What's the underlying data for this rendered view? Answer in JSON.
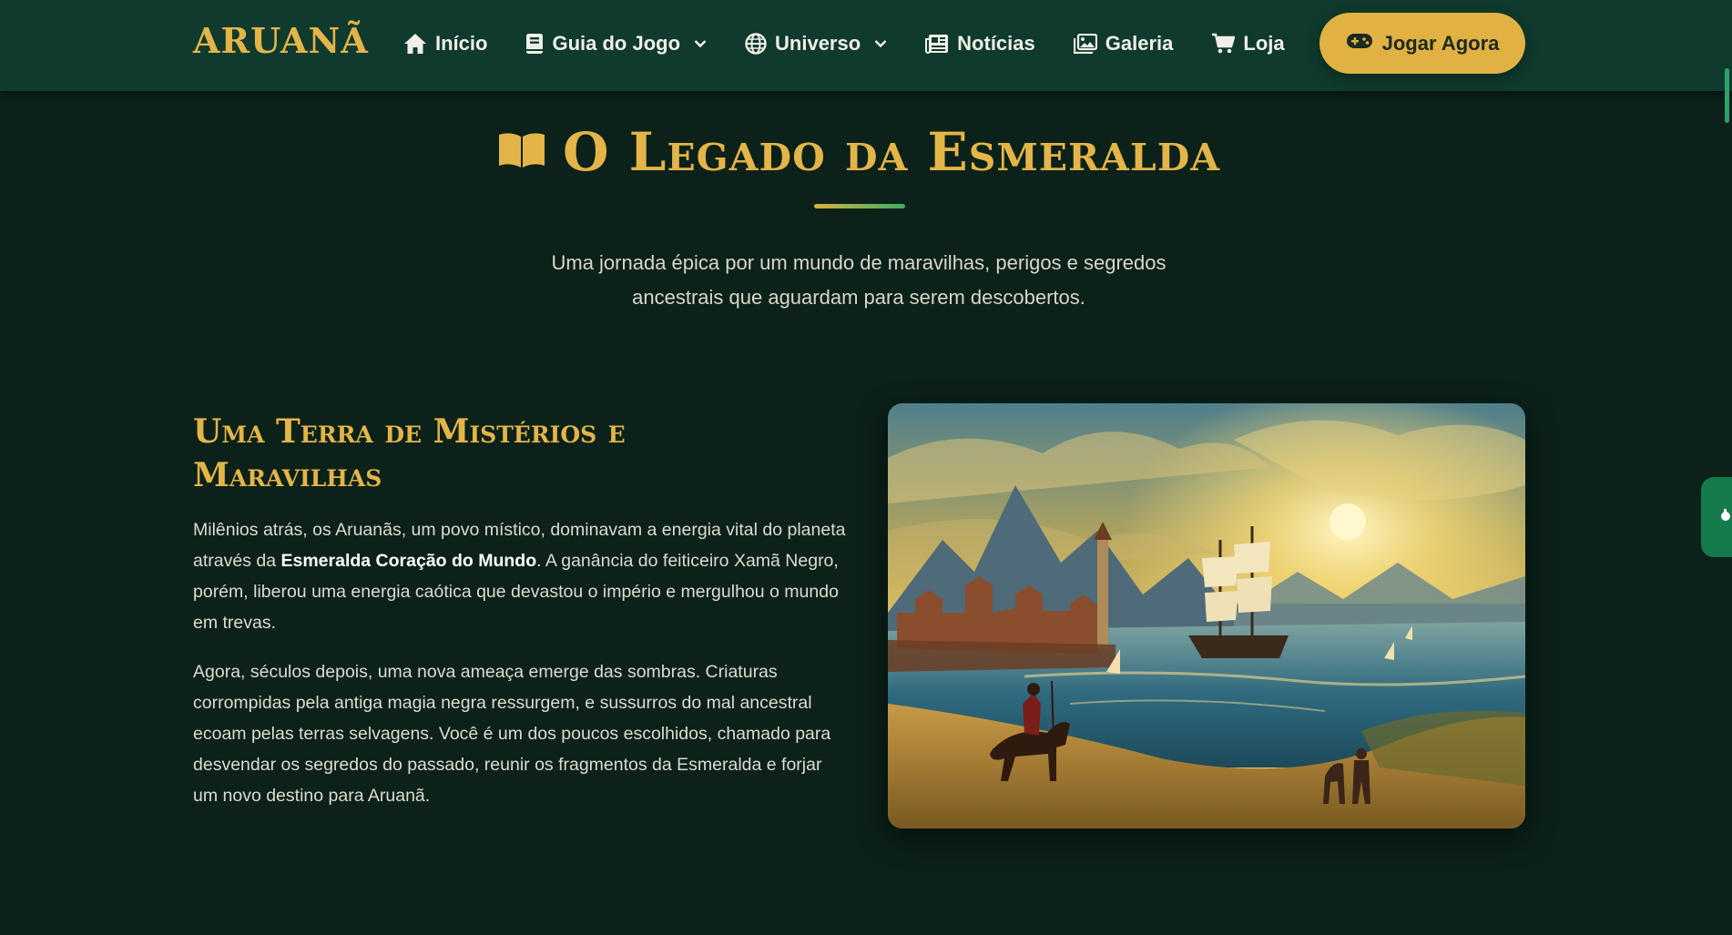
{
  "nav": {
    "brand": "ARUANÃ",
    "items": [
      {
        "label": "Início",
        "icon": "home-icon",
        "dropdown": false
      },
      {
        "label": "Guia do Jogo",
        "icon": "book-icon",
        "dropdown": true
      },
      {
        "label": "Universo",
        "icon": "globe-icon",
        "dropdown": true
      },
      {
        "label": "Notícias",
        "icon": "newspaper-icon",
        "dropdown": false
      },
      {
        "label": "Galeria",
        "icon": "images-icon",
        "dropdown": false
      },
      {
        "label": "Loja",
        "icon": "cart-icon",
        "dropdown": false
      }
    ],
    "cta_label": "Jogar Agora",
    "cta_icon": "gamepad-icon"
  },
  "hero": {
    "title": "O Legado da Esmeralda",
    "title_icon": "open-book-icon",
    "subtitle": "Uma jornada épica por um mundo de maravilhas, perigos e segredos ancestrais que aguardam para serem descobertos."
  },
  "story": {
    "heading": "Uma Terra de Mistérios e Maravilhas",
    "p1_before": "Milênios atrás, os Aruanãs, um povo místico, dominavam a energia vital do planeta através da ",
    "p1_strong": "Esmeralda Coração do Mundo",
    "p1_after": ". A ganância do feiticeiro Xamã Negro, porém, liberou uma energia caótica que devastou o império e mergulhou o mundo em trevas.",
    "p2": "Agora, séculos depois, uma nova ameaça emerge das sombras. Criaturas corrompidas pela antiga magia negra ressurgem, e sussurros do mal ancestral ecoam pelas terras selvagens. Você é um dos poucos escolhidos, chamado para desvendar os segredos do passado, reunir os fragmentos da Esmeralda e forjar um novo destino para Aruanã."
  },
  "colors": {
    "nav_bg": "#0f3a2d",
    "page_bg": "#0b2119",
    "gold": "#e3b448",
    "cta_bg": "#e1b143"
  }
}
